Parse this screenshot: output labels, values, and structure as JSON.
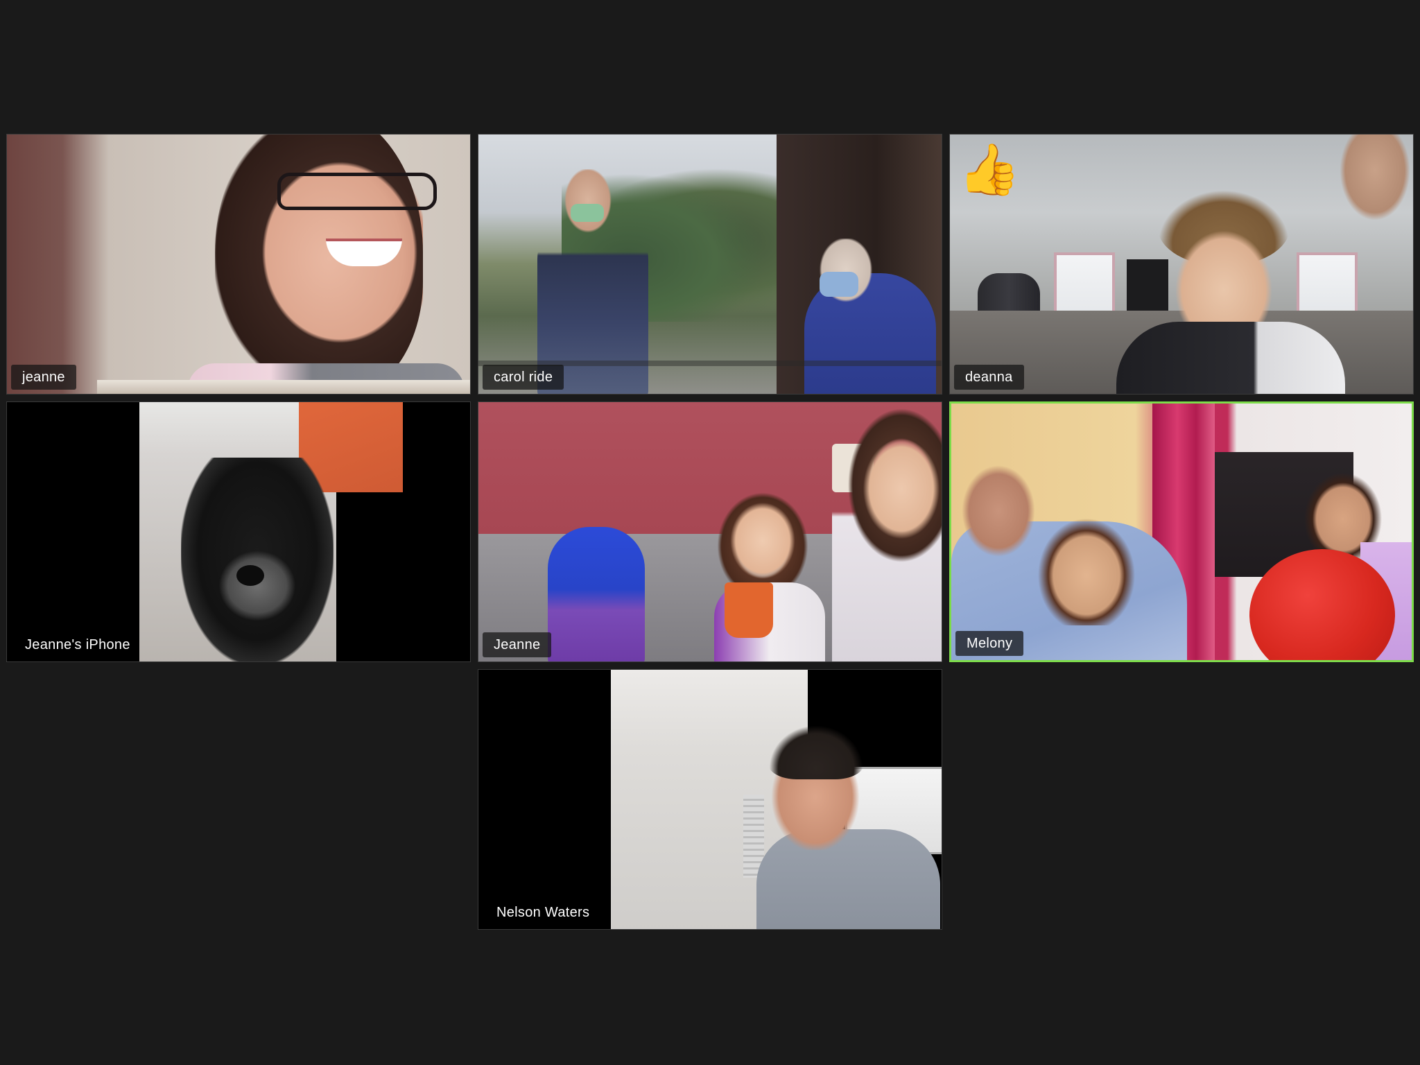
{
  "meeting": {
    "view": "gallery",
    "accent_active_speaker": "#7ddc4a"
  },
  "participants": [
    {
      "name": "jeanne",
      "active": false,
      "reaction": ""
    },
    {
      "name": "carol ride",
      "active": false,
      "reaction": ""
    },
    {
      "name": "deanna",
      "active": false,
      "reaction": "👍"
    },
    {
      "name": "Jeanne's iPhone",
      "active": false,
      "reaction": ""
    },
    {
      "name": "Jeanne",
      "active": false,
      "reaction": ""
    },
    {
      "name": "Melony",
      "active": true,
      "reaction": ""
    },
    {
      "name": "Nelson Waters",
      "active": false,
      "reaction": ""
    }
  ]
}
